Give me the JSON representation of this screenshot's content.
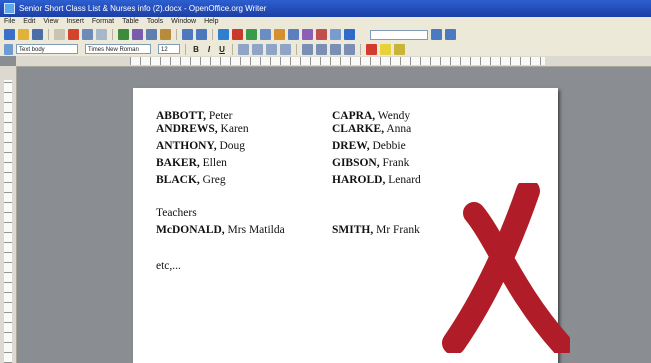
{
  "window": {
    "title": "Senior Short Class List & Nurses info (2).docx - OpenOffice.org Writer"
  },
  "menu": [
    "File",
    "Edit",
    "View",
    "Insert",
    "Format",
    "Table",
    "Tools",
    "Window",
    "Help"
  ],
  "format_bar": {
    "style": "Text body",
    "font": "Times New Roman",
    "size": "12"
  },
  "document": {
    "col_left": [
      {
        "surname": "ABBOTT,",
        "first": " Peter"
      },
      {
        "surname": "ANDREWS,",
        "first": " Karen"
      },
      {
        "surname": "ANTHONY,",
        "first": " Doug"
      },
      {
        "surname": "BAKER,",
        "first": " Ellen"
      },
      {
        "surname": "BLACK,",
        "first": " Greg"
      }
    ],
    "col_right": [
      {
        "surname": "CAPRA,",
        "first": " Wendy"
      },
      {
        "surname": "CLARKE,",
        "first": " Anna"
      },
      {
        "surname": "DREW,",
        "first": " Debbie"
      },
      {
        "surname": "GIBSON,",
        "first": " Frank"
      },
      {
        "surname": "HAROLD,",
        "first": " Lenard"
      }
    ],
    "teachers_heading": "Teachers",
    "teacher_left": {
      "surname": "McDONALD,",
      "first": " Mrs Matilda"
    },
    "teacher_right": {
      "surname": "SMITH,",
      "first": " Mr Frank"
    },
    "etc": "etc,..."
  },
  "colors": {
    "cross": "#b01c27"
  }
}
